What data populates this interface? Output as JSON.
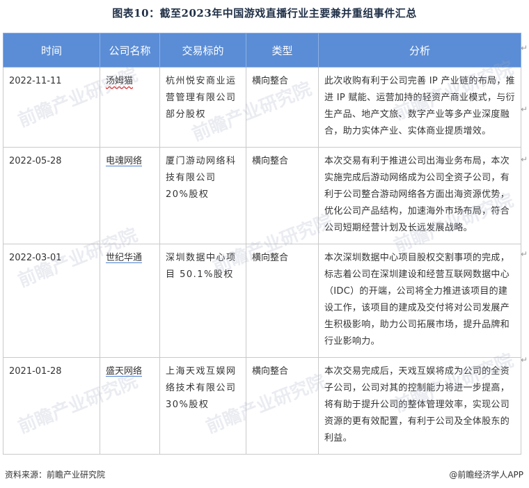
{
  "title": "图表10：截至2023年中国游戏直播行业主要兼并重组事件汇总",
  "headers": {
    "time": "时间",
    "company": "公司名称",
    "target": "交易标的",
    "type": "类型",
    "analysis": "分析"
  },
  "rows": [
    {
      "date": "2022-11-11",
      "company": "汤姆猫",
      "target": "杭州悦安商业运营管理有限公司部分股权",
      "type": "横向整合",
      "analysis": "此次收购有利于公司完善 IP 产业链的布局，推进 IP 赋能、运营加持的轻资产商业模式，与衍生产品、地产文旅、数字产业等多产业深度融合，助力实体产业、实体商业提质增效。"
    },
    {
      "date": "2022-05-28",
      "company": "电魂网络",
      "target": "厦门游动网络科技有限公司 20%股权",
      "type": "横向整合",
      "analysis": "本次交易有利于推进公司出海业务布局，本次实施完成后游动网络成为公司全资子公司，有利于公司整合游动网络各方面出海资源优势，优化公司产品结构，加速海外市场布局，符合公司短期经营计划及长远发展战略。"
    },
    {
      "date": "2022-03-01",
      "company": "世纪华通",
      "target": "深圳数据中心项目 50.1%股权",
      "type": "横向整合",
      "analysis": "本次深圳数据中心项目股权交割事项的完成，标志着公司在深圳建设和经营互联网数据中心（IDC）的开端，公司将全力推进该项目的建设工作，该项目的建成及交付将对公司发展产生积极影响，助力公司拓展市场，提升品牌和行业影响力。"
    },
    {
      "date": "2021-01-28",
      "company": "盛天网络",
      "target": "上海天戏互娱网络技术有限公司 30%股权",
      "type": "横向整合",
      "analysis": "本次交易完成后，天戏互娱将成为公司的全资子公司，公司对其的控制能力将进一步提高，将有助于提升公司的整体管理效率，实现公司资源的更有效配置，有利于公司及全体股东的利益。"
    }
  ],
  "footer": {
    "source": "资料来源：前瞻产业研究院",
    "brand": "@前瞻经济学人APP"
  },
  "watermark": "前瞻产业研究院",
  "colors": {
    "header_bg": "#5b8dd6",
    "title": "#1f2f46"
  }
}
